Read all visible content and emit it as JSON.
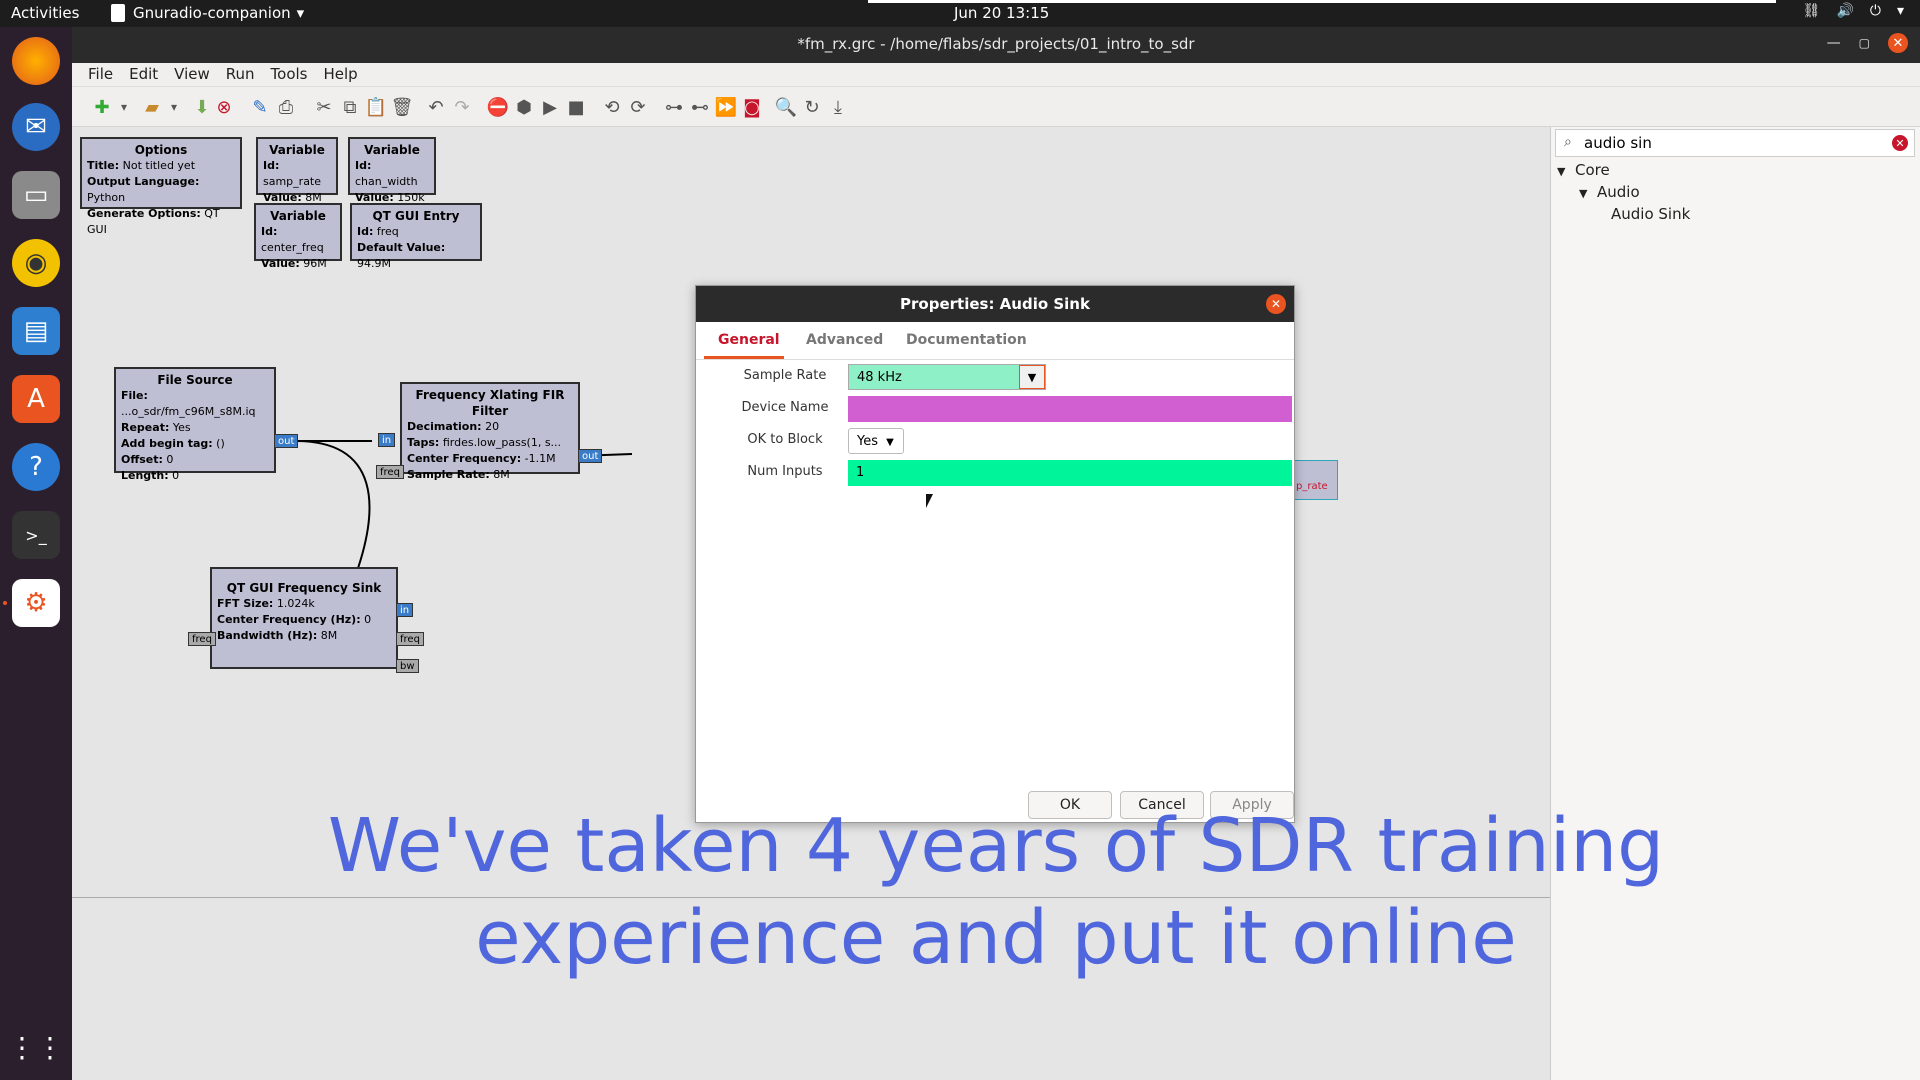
{
  "topbar": {
    "activities": "Activities",
    "app_name": "Gnuradio-companion",
    "clock": "Jun 20  13:15"
  },
  "window": {
    "title": "*fm_rx.grc - /home/flabs/sdr_projects/01_intro_to_sdr"
  },
  "menu": [
    "File",
    "Edit",
    "View",
    "Run",
    "Tools",
    "Help"
  ],
  "blocks": {
    "options": {
      "title": "Options",
      "l1k": "Title:",
      "l1v": " Not titled yet",
      "l2k": "Output Language:",
      "l2v": " Python",
      "l3k": "Generate Options:",
      "l3v": " QT GUI"
    },
    "var_samp": {
      "title": "Variable",
      "l1k": "Id:",
      "l1v": " samp_rate",
      "l2k": "Value:",
      "l2v": " 8M"
    },
    "var_chan": {
      "title": "Variable",
      "l1k": "Id:",
      "l1v": " chan_width",
      "l2k": "Value:",
      "l2v": " 150k"
    },
    "var_center": {
      "title": "Variable",
      "l1k": "Id:",
      "l1v": " center_freq",
      "l2k": "Value:",
      "l2v": " 96M"
    },
    "qt_entry": {
      "title": "QT GUI Entry",
      "l1k": "Id:",
      "l1v": " freq",
      "l2k": "Default Value:",
      "l2v": " 94.9M"
    },
    "file_source": {
      "title": "File Source",
      "l1k": "File:",
      "l1v": " ...o_sdr/fm_c96M_s8M.iq",
      "l2k": "Repeat:",
      "l2v": " Yes",
      "l3k": "Add begin tag:",
      "l3v": " ()",
      "l4k": "Offset:",
      "l4v": " 0",
      "l5k": "Length:",
      "l5v": " 0",
      "port_out": "out"
    },
    "fxlating": {
      "title": "Frequency Xlating FIR Filter",
      "l1k": "Decimation:",
      "l1v": " 20",
      "l2k": "Taps:",
      "l2v": " firdes.low_pass(1, s...",
      "l3k": "Center Frequency:",
      "l3v": " -1.1M",
      "l4k": "Sample Rate:",
      "l4v": " 8M",
      "port_in": "in",
      "port_freq": "freq",
      "port_out": "out"
    },
    "freq_sink": {
      "title": "QT GUI Frequency Sink",
      "l1k": "FFT Size:",
      "l1v": " 1.024k",
      "l2k": "Center Frequency (Hz):",
      "l2v": " 0",
      "l3k": "Bandwidth (Hz):",
      "l3v": " 8M",
      "port_in": "in",
      "port_freq_l": "freq",
      "port_freq_r": "freq",
      "port_bw": "bw"
    },
    "hidden_block_label": "p_rate"
  },
  "sidepanel": {
    "search_value": "audio sin",
    "tree": [
      "Core",
      "Audio",
      "Audio Sink"
    ]
  },
  "dialog": {
    "title": "Properties: Audio Sink",
    "tabs": [
      "General",
      "Advanced",
      "Documentation"
    ],
    "fields": [
      {
        "label": "Sample Rate",
        "value": "48 kHz",
        "color": "#8ef0c6"
      },
      {
        "label": "Device Name",
        "value": "",
        "color": "#d25fd2"
      },
      {
        "label": "OK to Block",
        "value": "Yes",
        "color": "#ffffff"
      },
      {
        "label": "Num Inputs",
        "value": "1",
        "color": "#00f59b"
      }
    ],
    "buttons": {
      "ok": "OK",
      "cancel": "Cancel",
      "apply": "Apply"
    }
  },
  "subtitle": {
    "line1": "We've taken 4 years of SDR training",
    "line2": "experience and put it online"
  }
}
